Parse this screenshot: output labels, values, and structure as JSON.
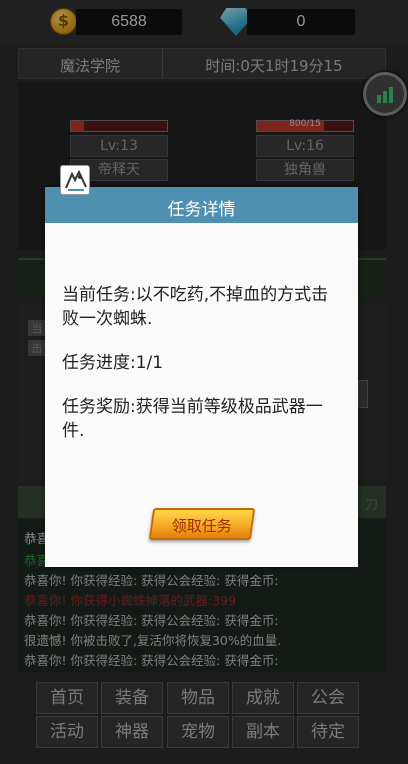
{
  "topbar": {
    "gold": "6588",
    "gems": "0"
  },
  "location": {
    "name": "魔法学院",
    "time": "时间:0天1时19分15"
  },
  "battle": {
    "player": {
      "hp_text": "",
      "level": "Lv:13",
      "name": "帝释天"
    },
    "enemy": {
      "hp_text": "800/15",
      "level": "Lv:16",
      "name": "独角兽"
    }
  },
  "panels": {
    "green_text": "",
    "box1": "当",
    "box2": "击",
    "right_text": "刀"
  },
  "log": [
    {
      "text": "恭喜",
      "color": "#d8d8d8"
    },
    {
      "text": "恭喜你!",
      "color": "#2e9e3e"
    },
    {
      "text": "恭喜你!  你获得经验:      获得公会经验:  获得金币:",
      "color": "#c4c4c4"
    },
    {
      "text": "恭喜你!  你获得小蜘蛛掉落的武器:399",
      "color": "#9b2a2a"
    },
    {
      "text": "恭喜你!  你获得经验:      获得公会经验:  获得金币:",
      "color": "#c4c4c4"
    },
    {
      "text": "很遗憾!  你被击败了,复活你将恢复30%的血量.",
      "color": "#c4c4c4"
    },
    {
      "text": "恭喜你!  你获得经验:      获得公会经验:  获得金币:",
      "color": "#c4c4c4"
    }
  ],
  "nav": {
    "row1": [
      "首页",
      "装备",
      "物品",
      "成就",
      "公会"
    ],
    "row2": [
      "活动",
      "神器",
      "宠物",
      "副本",
      "待定"
    ]
  },
  "modal": {
    "title": "任务详情",
    "current_task": "当前任务:以不吃药,不掉血的方式击败一次蜘蛛.",
    "progress": "任务进度:1/1",
    "reward": "任务奖励:获得当前等级极品武器一件.",
    "claim_label": "领取任务"
  },
  "icons": {
    "coin": "coin-icon",
    "gem": "diamond-icon",
    "stats": "bar-chart-icon",
    "quest": "quest-portrait-icon"
  }
}
